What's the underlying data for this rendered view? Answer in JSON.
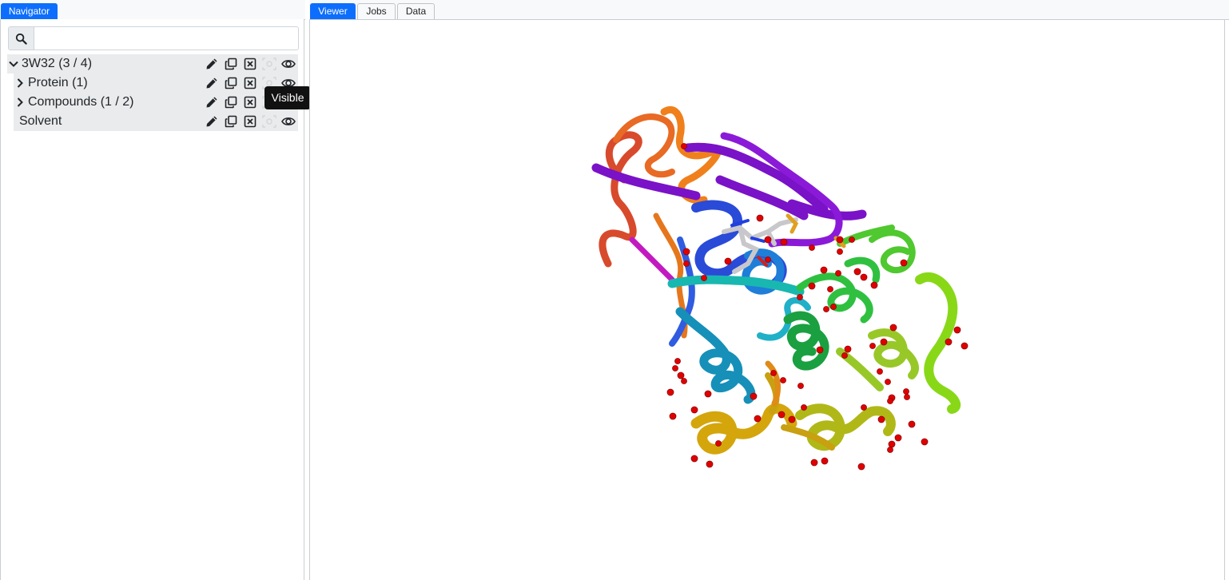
{
  "left_tabs": [
    {
      "label": "Navigator",
      "active": true
    }
  ],
  "right_tabs": [
    {
      "label": "Viewer",
      "active": true
    },
    {
      "label": "Jobs",
      "active": false
    },
    {
      "label": "Data",
      "active": false
    }
  ],
  "search": {
    "value": "",
    "placeholder": ""
  },
  "tree": [
    {
      "label": "3W32 (3 / 4)",
      "expanded": true
    },
    {
      "label": "Protein (1)",
      "expanded": false
    },
    {
      "label": "Compounds (1 / 2)",
      "expanded": false
    },
    {
      "label": "Solvent"
    }
  ],
  "row_actions": [
    "pencil-icon",
    "copy-icon",
    "close-square-icon",
    "focus-icon",
    "eye-icon"
  ],
  "tooltip": {
    "text": "Visible"
  },
  "colors": {
    "accent": "#0d6efd",
    "row_bg": "#eaebec",
    "tooltip_bg": "#111111",
    "water": "#e00000"
  }
}
